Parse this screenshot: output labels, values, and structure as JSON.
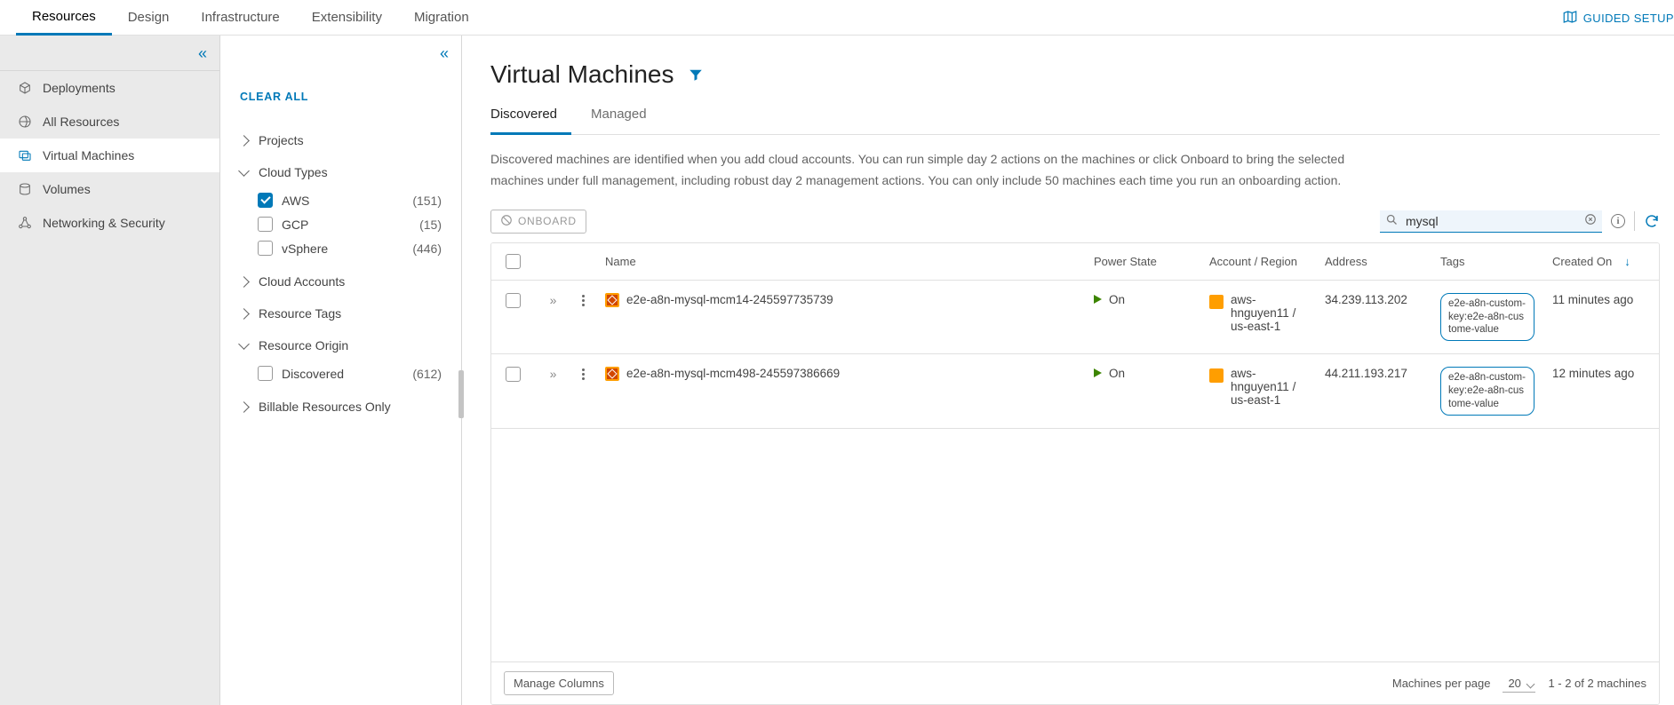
{
  "topTabs": {
    "items": [
      "Resources",
      "Design",
      "Infrastructure",
      "Extensibility",
      "Migration"
    ],
    "activeIndex": 0
  },
  "guidedSetup": "GUIDED SETUP",
  "sideNav": {
    "items": [
      {
        "id": "deployments",
        "label": "Deployments"
      },
      {
        "id": "all-resources",
        "label": "All Resources"
      },
      {
        "id": "virtual-machines",
        "label": "Virtual Machines"
      },
      {
        "id": "volumes",
        "label": "Volumes"
      },
      {
        "id": "networking-security",
        "label": "Networking & Security"
      }
    ],
    "activeIndex": 2
  },
  "filters": {
    "clearAll": "CLEAR ALL",
    "groups": {
      "projects": {
        "label": "Projects",
        "open": false
      },
      "cloudTypes": {
        "label": "Cloud Types",
        "open": true,
        "options": [
          {
            "id": "aws",
            "label": "AWS",
            "count": "(151)",
            "checked": true
          },
          {
            "id": "gcp",
            "label": "GCP",
            "count": "(15)",
            "checked": false
          },
          {
            "id": "vsphere",
            "label": "vSphere",
            "count": "(446)",
            "checked": false
          }
        ]
      },
      "cloudAccounts": {
        "label": "Cloud Accounts",
        "open": false
      },
      "resourceTags": {
        "label": "Resource Tags",
        "open": false
      },
      "resourceOrigin": {
        "label": "Resource Origin",
        "open": true,
        "options": [
          {
            "id": "discovered",
            "label": "Discovered",
            "count": "(612)",
            "checked": false
          }
        ]
      },
      "billable": {
        "label": "Billable Resources Only",
        "open": false
      }
    }
  },
  "page": {
    "title": "Virtual Machines",
    "subTabs": {
      "items": [
        "Discovered",
        "Managed"
      ],
      "activeIndex": 0
    },
    "description": "Discovered machines are identified when you add cloud accounts. You can run simple day 2 actions on the machines or click Onboard to bring the selected machines under full management, including robust day 2 management actions. You can only include 50 machines each time you run an onboarding action."
  },
  "toolbar": {
    "onboardLabel": "ONBOARD",
    "searchValue": "mysql"
  },
  "table": {
    "headers": {
      "name": "Name",
      "powerState": "Power State",
      "accountRegion": "Account / Region",
      "address": "Address",
      "tags": "Tags",
      "createdOn": "Created On"
    },
    "rows": [
      {
        "name": "e2e-a8n-mysql-mcm14-245597735739",
        "power": "On",
        "account": "aws-hnguyen11 / us-east-1",
        "address": "34.239.113.202",
        "tag": "e2e-a8n-custom-key:e2e-a8n-custome-value",
        "created": "11 minutes ago"
      },
      {
        "name": "e2e-a8n-mysql-mcm498-245597386669",
        "power": "On",
        "account": "aws-hnguyen11 / us-east-1",
        "address": "44.211.193.217",
        "tag": "e2e-a8n-custom-key:e2e-a8n-custome-value",
        "created": "12 minutes ago"
      }
    ],
    "footer": {
      "manageColumns": "Manage Columns",
      "perPageLabel": "Machines per page",
      "perPageValue": "20",
      "rangeText": "1 - 2 of 2 machines"
    }
  }
}
